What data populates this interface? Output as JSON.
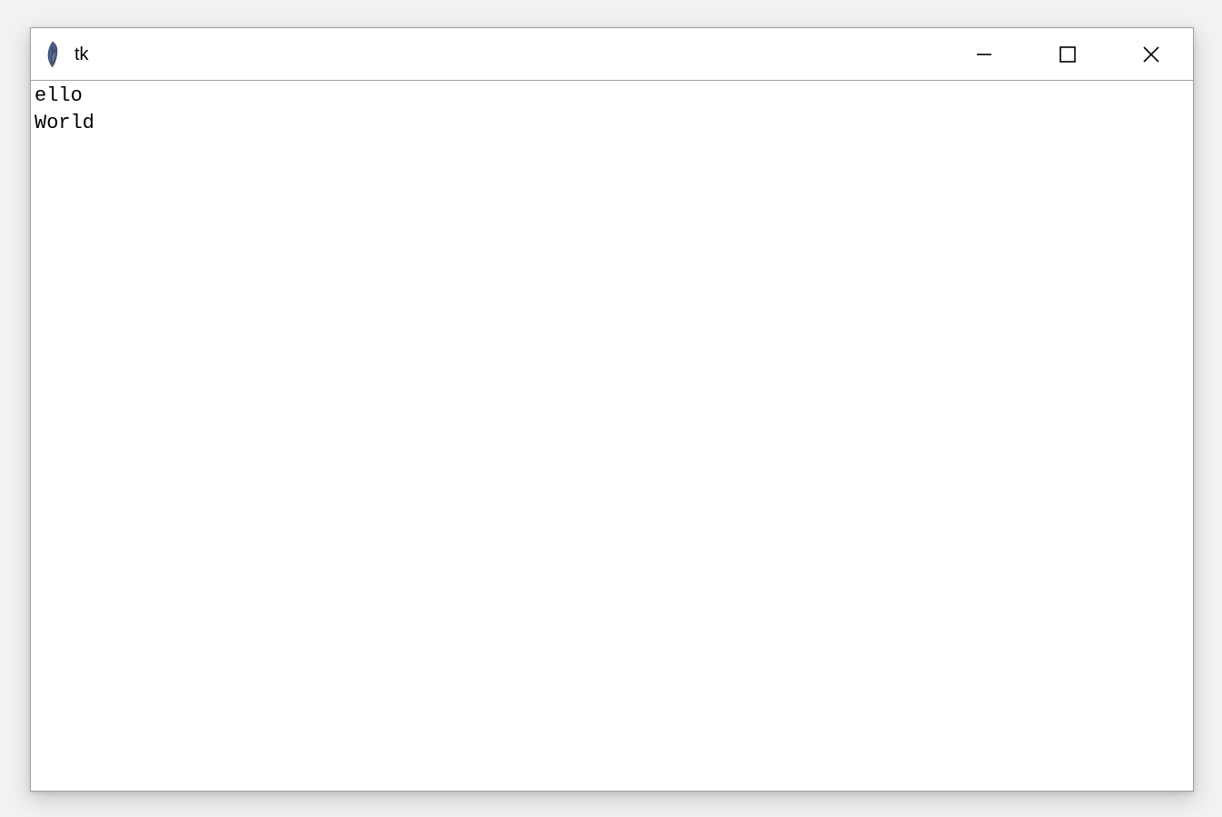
{
  "window": {
    "title": "tk"
  },
  "text": {
    "content": "ello\nWorld"
  }
}
